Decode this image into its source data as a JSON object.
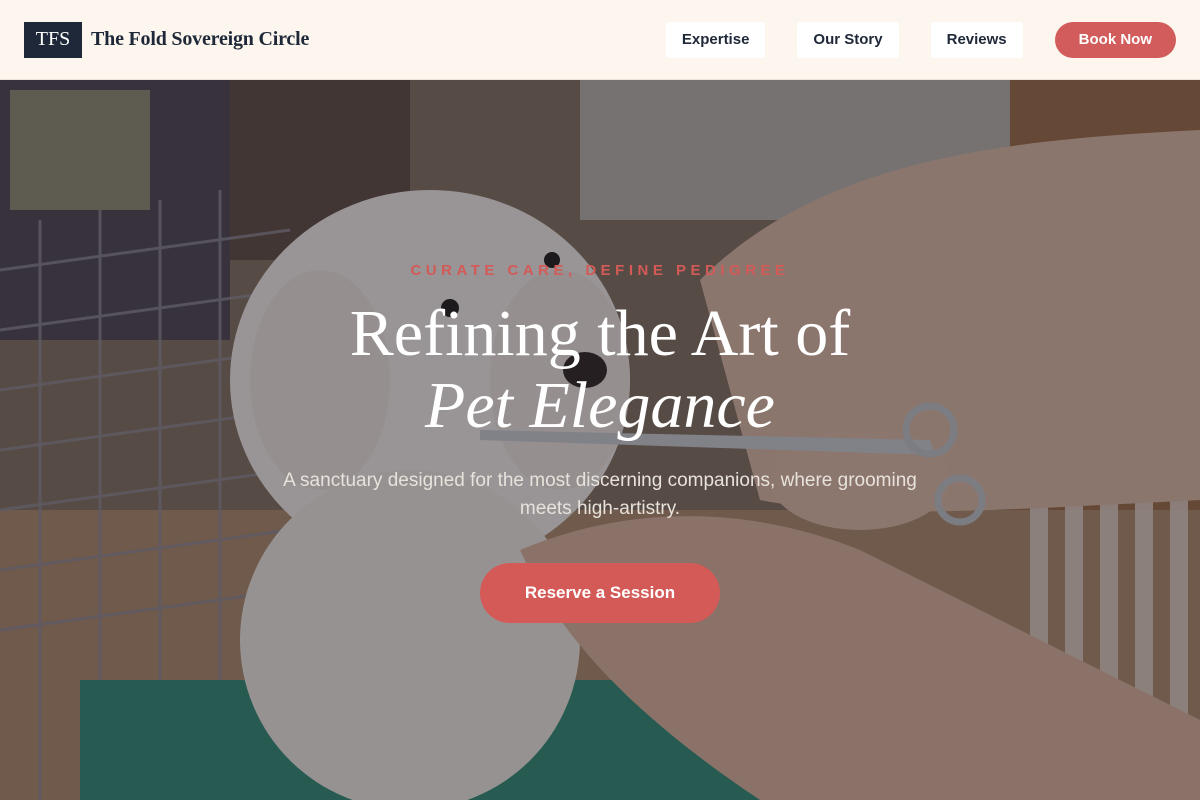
{
  "header": {
    "logo_text": "TFS",
    "brand_name": "The Fold Sovereign Circle",
    "nav": [
      "Expertise",
      "Our Story",
      "Reviews"
    ],
    "book_label": "Book Now"
  },
  "hero": {
    "eyebrow": "CURATE CARE, DEFINE PEDIGREE",
    "headline_line1": "Refining the Art of",
    "headline_line2": "Pet Elegance",
    "subtext": "A sanctuary designed for the most discerning companions, where grooming meets high-artistry.",
    "cta_label": "Reserve a Session",
    "image_description_icon": "poodle-grooming-photo"
  },
  "colors": {
    "header_bg": "#fdf6ee",
    "logo_bg": "#1e2838",
    "accent": "#d25c5c",
    "text_dark": "#1e2838"
  }
}
